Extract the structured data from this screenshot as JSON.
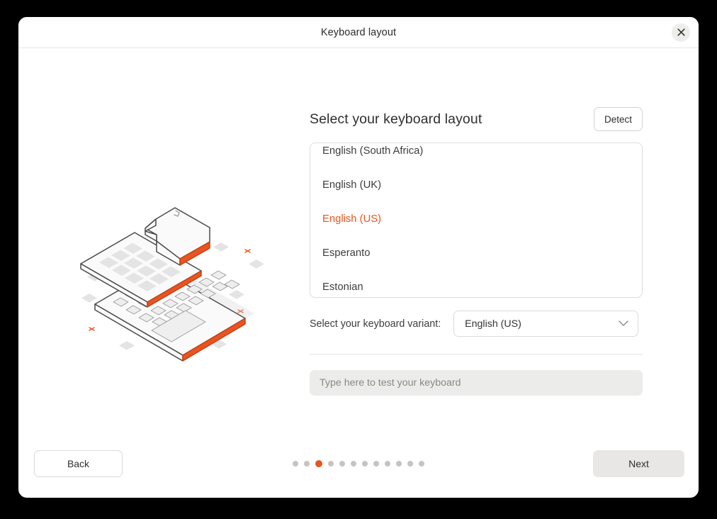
{
  "window": {
    "title": "Keyboard layout",
    "close_icon": "close-icon"
  },
  "main": {
    "page_title": "Select your keyboard layout",
    "detect_label": "Detect",
    "layout_list": {
      "items": [
        {
          "label": "English (South Africa)",
          "selected": false
        },
        {
          "label": "English (UK)",
          "selected": false
        },
        {
          "label": "English (US)",
          "selected": true
        },
        {
          "label": "Esperanto",
          "selected": false
        },
        {
          "label": "Estonian",
          "selected": false
        }
      ]
    },
    "variant": {
      "label": "Select your keyboard variant:",
      "value": "English (US)",
      "chevron_icon": "chevron-down-icon"
    },
    "test_entry": {
      "value": "",
      "placeholder": "Type here to test your keyboard"
    },
    "illustration": {
      "name": "isometric-keyboard-layers-illustration"
    }
  },
  "footer": {
    "back_label": "Back",
    "next_label": "Next",
    "pagination": {
      "total": 12,
      "active_index": 2
    }
  },
  "colors": {
    "accent": "#e95420",
    "dot_inactive": "#c6c4c1",
    "window_bg": "#ffffff",
    "page_bg": "#000000",
    "entry_bg": "#ececea",
    "next_bg": "#e8e7e5"
  }
}
